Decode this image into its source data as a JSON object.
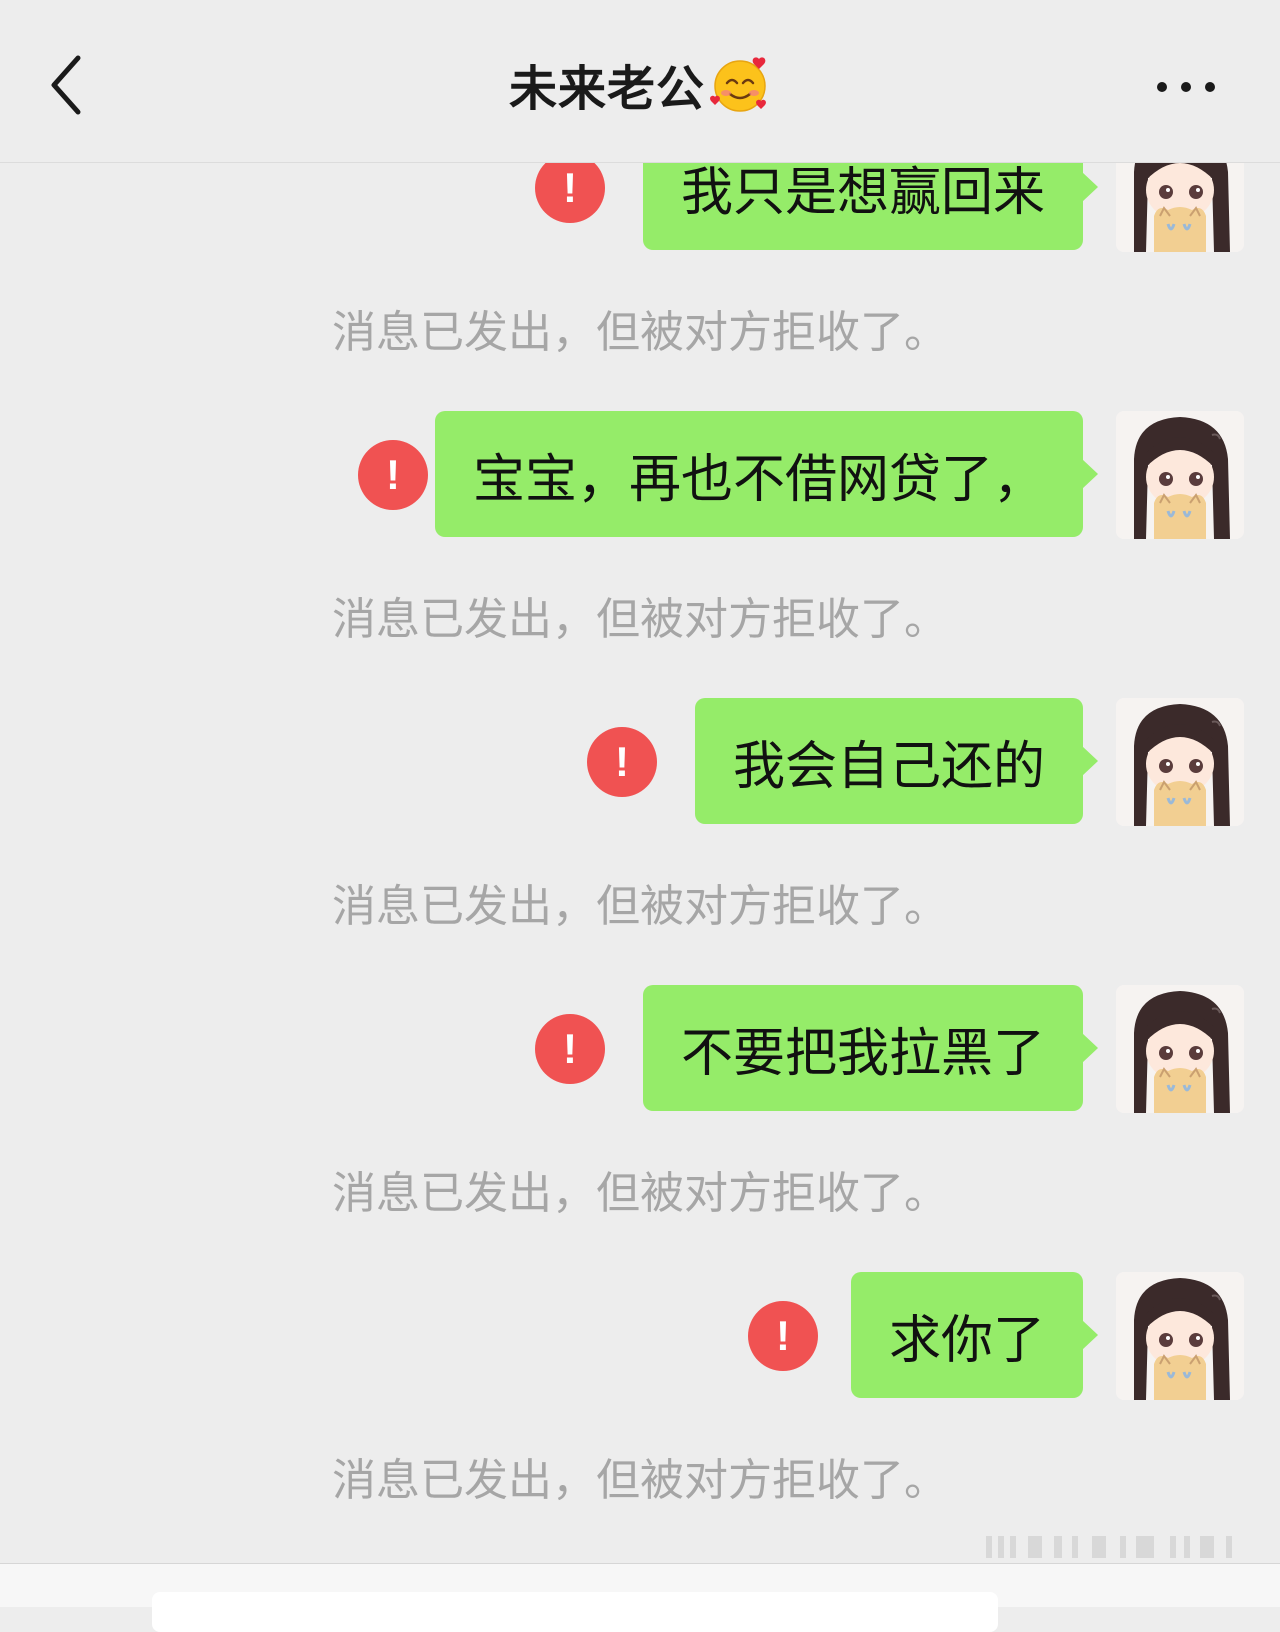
{
  "header": {
    "title": "未来老公",
    "back_icon": "chevron-left-icon",
    "title_emoji": "smiling-face-with-hearts-icon",
    "more_icon": "more-horizontal-icon"
  },
  "messages": [
    {
      "text": "我只是想赢回来",
      "direction": "outgoing",
      "status": "failed",
      "notice": "消息已发出，但被对方拒收了。"
    },
    {
      "text": "宝宝，再也不借网贷了，",
      "direction": "outgoing",
      "status": "failed",
      "notice": "消息已发出，但被对方拒收了。"
    },
    {
      "text": "我会自己还的",
      "direction": "outgoing",
      "status": "failed",
      "notice": "消息已发出，但被对方拒收了。"
    },
    {
      "text": "不要把我拉黑了",
      "direction": "outgoing",
      "status": "failed",
      "notice": "消息已发出，但被对方拒收了。"
    },
    {
      "text": "求你了",
      "direction": "outgoing",
      "status": "failed",
      "notice": "消息已发出，但被对方拒收了。"
    }
  ],
  "colors": {
    "background": "#ededed",
    "bubble": "#95ec69",
    "error": "#f05252",
    "notice_text": "#a6a6a6"
  },
  "avatar_icon": "cartoon-girl-avatar-icon",
  "error_icon": "exclamation-icon"
}
